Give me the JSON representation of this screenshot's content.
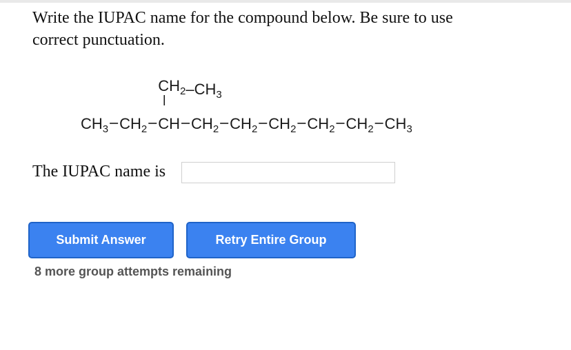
{
  "question": {
    "line1": "Write the IUPAC name for the compound below. Be sure to use",
    "line2": "correct punctuation."
  },
  "formula": {
    "branch": [
      "CH",
      "2",
      "–CH",
      "3"
    ],
    "main_chain": [
      [
        "CH",
        "3"
      ],
      [
        "CH",
        "2"
      ],
      [
        "CH",
        ""
      ],
      [
        "CH",
        "2"
      ],
      [
        "CH",
        "2"
      ],
      [
        "CH",
        "2"
      ],
      [
        "CH",
        "2"
      ],
      [
        "CH",
        "2"
      ],
      [
        "CH",
        "3"
      ]
    ]
  },
  "answer": {
    "label": "The IUPAC name is",
    "value": "",
    "placeholder": ""
  },
  "buttons": {
    "submit": "Submit Answer",
    "retry": "Retry Entire Group"
  },
  "attempts_text": "8 more group attempts remaining",
  "colors": {
    "button_bg": "#3b82f0",
    "button_border": "#1f63c8",
    "button_text": "#ffffff",
    "attempts_text": "#555555"
  }
}
